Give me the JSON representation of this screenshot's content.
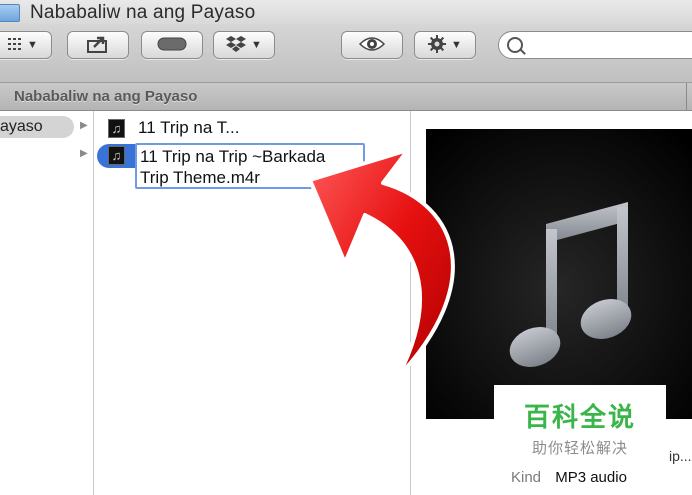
{
  "window": {
    "title": "Nababaliw na ang Payaso"
  },
  "toolbar": {
    "view_icon": "grid-view-icon",
    "share_icon": "share-icon",
    "toggle_icon": "toggle-icon",
    "dropbox_icon": "dropbox-icon",
    "quicklook_icon": "eye-icon",
    "action_icon": "gear-icon",
    "search_placeholder": ""
  },
  "pathbar": {
    "label": "Nababaliw na ang Payaso"
  },
  "column1": {
    "selected_label": "ayaso"
  },
  "column2": {
    "items": [
      {
        "name": "11 Trip na T..."
      },
      {
        "rename_line1": "11 Trip na Trip ~Barkada",
        "rename_line2": "Trip Theme.m4r"
      }
    ]
  },
  "preview": {
    "artwork_icon": "music-note-icon",
    "name_truncated": "ip...",
    "kind_label": "Kind",
    "kind_value": "MP3 audio"
  },
  "watermark": {
    "title": "百科全说",
    "subtitle": "助你轻松解决"
  },
  "colors": {
    "selection": "#3a73d8",
    "arrow": "#e81414",
    "watermark_green": "#39b54a"
  }
}
